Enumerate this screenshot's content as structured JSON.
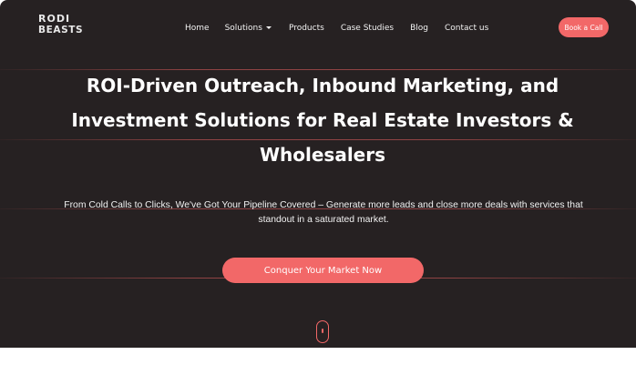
{
  "logo": {
    "line1": "RODI",
    "line2": "BEASTS"
  },
  "nav": {
    "home": "Home",
    "solutions": "Solutions",
    "products": "Products",
    "case_studies": "Case Studies",
    "blog": "Blog",
    "contact": "Contact us"
  },
  "header": {
    "book_call": "Book a Call"
  },
  "hero": {
    "headline": "ROI-Driven Outreach, Inbound Marketing, and Investment Solutions for Real Estate Investors & Wholesalers",
    "subtitle": "From Cold Calls to Clicks, We've Got Your Pipeline Covered – Generate more leads and close more deals with services that standout in a saturated market.",
    "cta": "Conquer Your Market Now"
  },
  "colors": {
    "background": "#262122",
    "accent": "#f26868",
    "text": "#ffffff"
  },
  "icons": {
    "scroll": "mouse-scroll-icon",
    "dropdown": "caret-down-icon"
  }
}
